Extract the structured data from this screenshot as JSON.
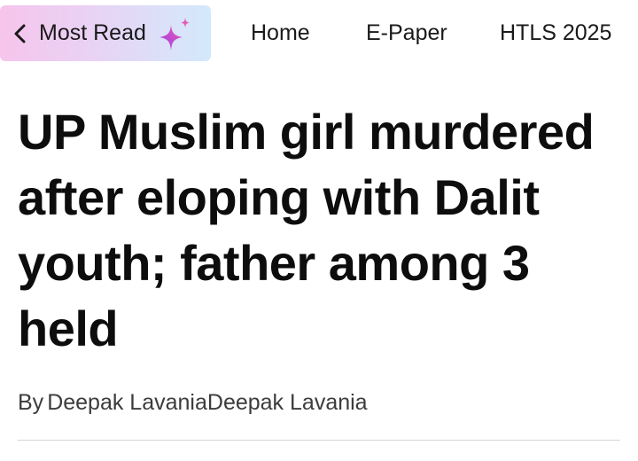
{
  "nav": {
    "most_read_label": "Most Read",
    "links": [
      {
        "label": "Home"
      },
      {
        "label": "E-Paper"
      },
      {
        "label": "HTLS 2025"
      }
    ]
  },
  "article": {
    "headline": "UP Muslim girl murdered after eloping with Dalit youth; father among 3 held",
    "byline_prefix": "By",
    "author_name": "Deepak Lavania",
    "author_name_repeat": "Deepak Lavania"
  },
  "icons": {
    "back": "chevron-left-icon",
    "sparkle": "sparkle-icon"
  },
  "colors": {
    "most_read_gradient_start": "#f7c4ec",
    "most_read_gradient_end": "#d3e9fb",
    "sparkle_primary": "#a03ee0",
    "sparkle_secondary": "#e85ab8"
  }
}
